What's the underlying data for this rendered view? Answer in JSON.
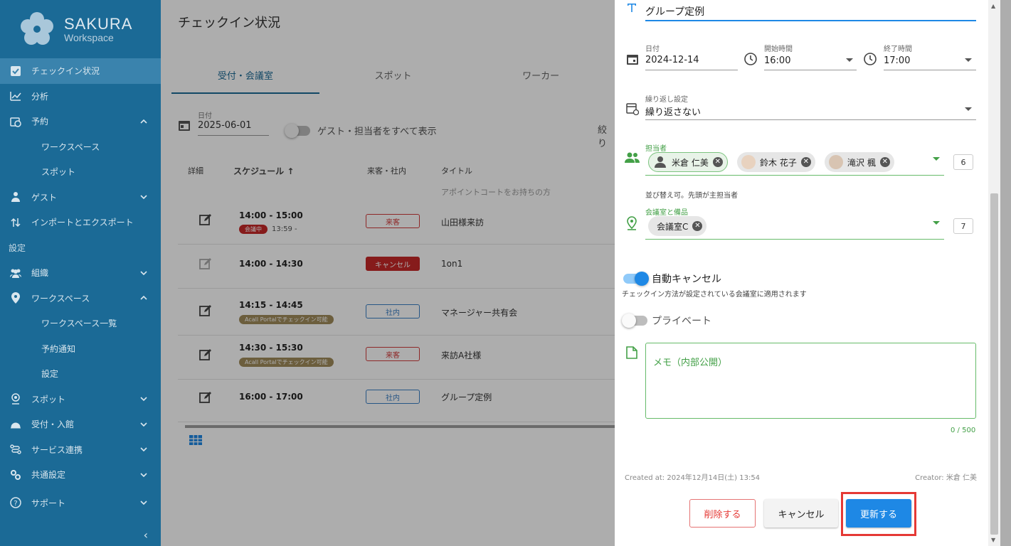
{
  "brand": {
    "title": "SAKURA",
    "subtitle": "Workspace"
  },
  "sidebar": {
    "items": [
      {
        "label": "チェックイン状況",
        "icon": "checkbox-icon"
      },
      {
        "label": "分析",
        "icon": "chart-icon"
      },
      {
        "label": "予約",
        "icon": "calendar-clock-icon"
      },
      {
        "label": "ワークスペース"
      },
      {
        "label": "スポット"
      },
      {
        "label": "ゲスト",
        "icon": "guest-icon"
      },
      {
        "label": "インポートとエクスポート",
        "icon": "import-export-icon"
      },
      {
        "label": "設定"
      },
      {
        "label": "組織",
        "icon": "group-icon"
      },
      {
        "label": "ワークスペース",
        "icon": "pin-icon"
      },
      {
        "label": "ワークスペース一覧"
      },
      {
        "label": "予約通知"
      },
      {
        "label": "設定"
      },
      {
        "label": "スポット",
        "icon": "spot-icon"
      },
      {
        "label": "受付・入館",
        "icon": "reception-icon"
      },
      {
        "label": "サービス連携",
        "icon": "integration-icon"
      },
      {
        "label": "共通設定",
        "icon": "settings-icon"
      },
      {
        "label": "サポート",
        "icon": "help-icon"
      }
    ],
    "collapse": "‹"
  },
  "main": {
    "title": "チェックイン状況",
    "tabs": [
      "受付・会議室",
      "スポット",
      "ワーカー"
    ],
    "date_label": "日付",
    "date_value": "2025-06-01",
    "toggle_label": "ゲスト・担当者をすべて表示",
    "filter_label": "絞り",
    "columns": [
      "詳細",
      "スケジュール ↑",
      "来客・社内",
      "タイトル"
    ],
    "partial_row_title": "アポイントコートをお持ちの方",
    "rows": [
      {
        "time": "14:00 - 15:00",
        "pill": "会議中",
        "pill_extra": "13:59 -",
        "badge": "来客",
        "title": "山田様来訪"
      },
      {
        "time": "14:00 - 14:30",
        "badge": "キャンセル",
        "title": "1on1"
      },
      {
        "time": "14:15 - 14:45",
        "pill": "Acall Portalでチェックイン可能",
        "badge": "社内",
        "title": "マネージャー共有会"
      },
      {
        "time": "14:30 - 15:30",
        "pill": "Acall Portalでチェックイン可能",
        "badge": "来客",
        "title": "来訪A社様"
      },
      {
        "time": "16:00 - 17:00",
        "badge": "社内",
        "title": "グループ定例"
      }
    ]
  },
  "panel": {
    "title_value": "グループ定例",
    "date_label": "日付",
    "date_value": "2024-12-14",
    "start_label": "開始時間",
    "start_value": "16:00",
    "end_label": "終了時間",
    "end_value": "17:00",
    "repeat_label": "繰り返し設定",
    "repeat_value": "繰り返さない",
    "hosts_label": "担当者",
    "hosts": [
      "米倉 仁美",
      "鈴木 花子",
      "滝沢 楓"
    ],
    "hosts_count": "6",
    "hosts_hint": "並び替え可。先頭が主担当者",
    "rooms_label": "会議室と備品",
    "rooms": [
      "会議室C"
    ],
    "rooms_count": "7",
    "auto_cancel_label": "自動キャンセル",
    "auto_cancel_hint": "チェックイン方法が設定されている会議室に適用されます",
    "private_label": "プライベート",
    "memo_placeholder": "メモ（内部公開）",
    "memo_counter": "0 / 500",
    "created_at": "Created at: 2024年12月14日(土) 13:54",
    "creator": "Creator: 米倉 仁美",
    "delete_label": "削除する",
    "cancel_label": "キャンセル",
    "update_label": "更新する"
  },
  "colors": {
    "sidebar": "#1b6a96",
    "accent": "#1e88e5",
    "green": "#43a047",
    "danger": "#e53935"
  }
}
